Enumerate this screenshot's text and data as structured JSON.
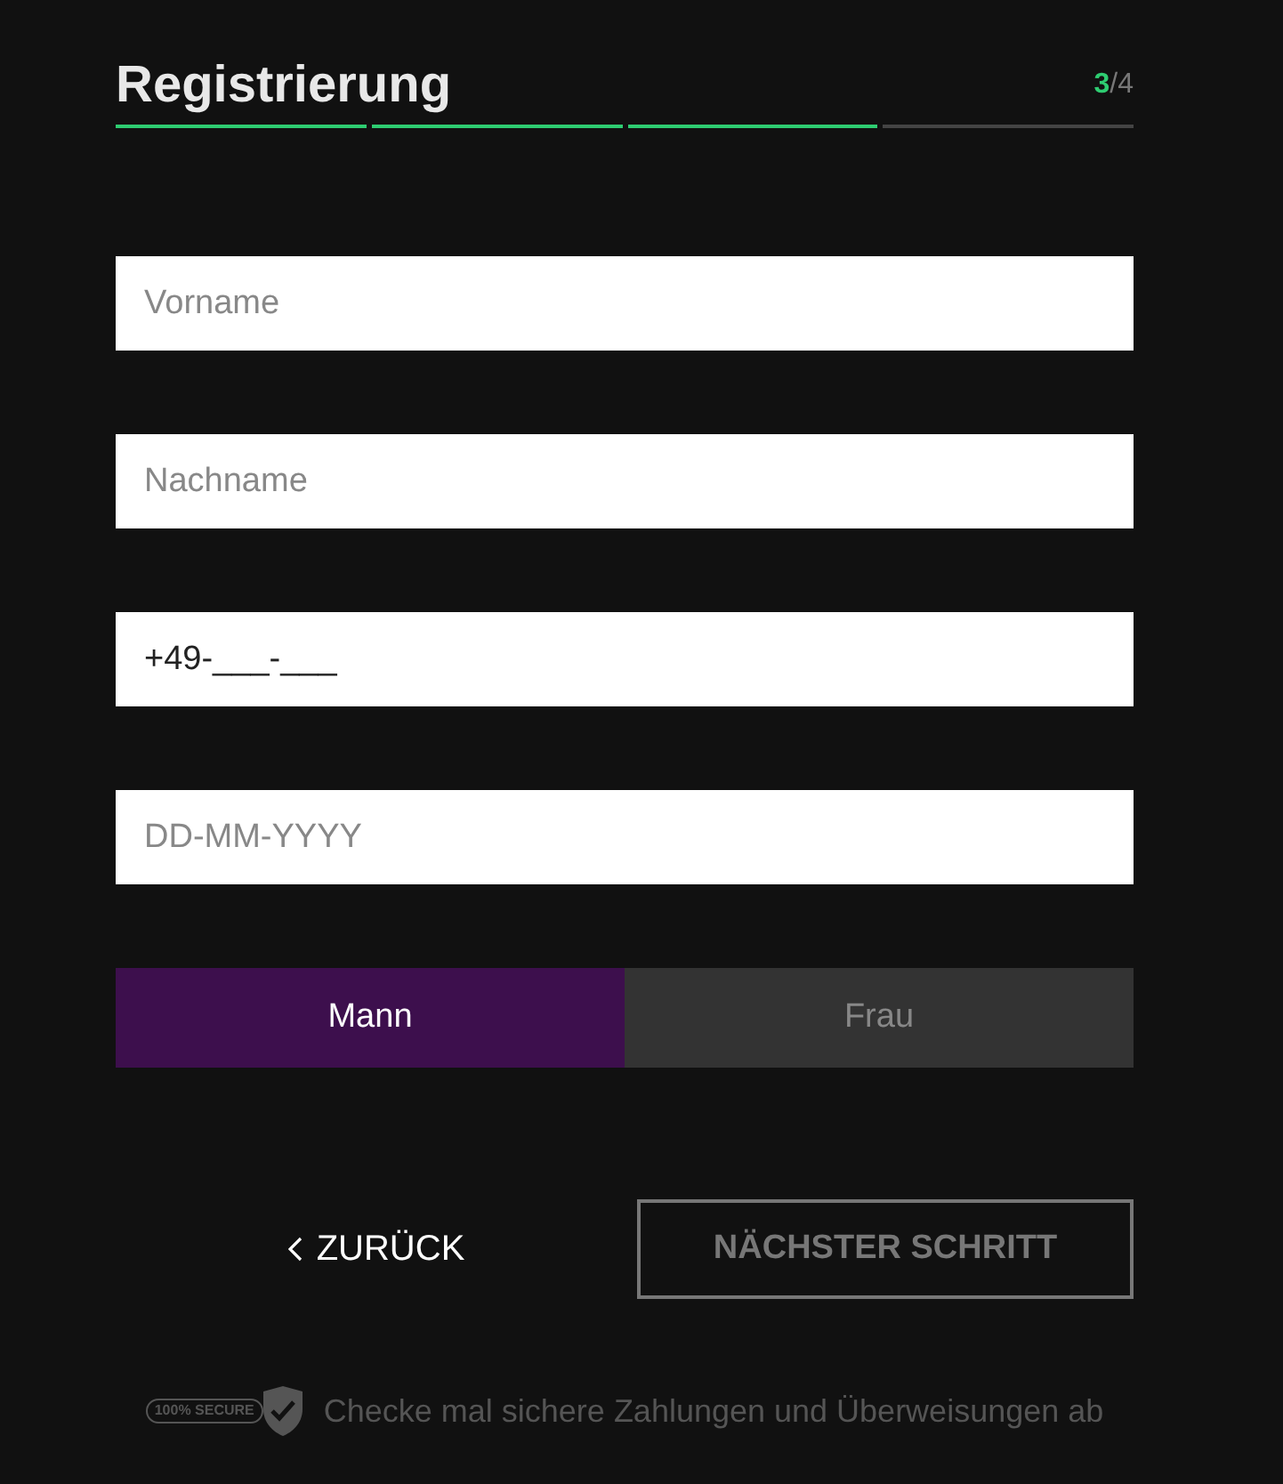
{
  "title": "Registrierung",
  "step": {
    "current": "3",
    "total": "/4"
  },
  "progress": [
    {
      "done": true
    },
    {
      "done": true
    },
    {
      "done": true
    },
    {
      "done": false
    }
  ],
  "fields": [
    {
      "placeholder": "Vorname"
    },
    {
      "placeholder": "Nachname"
    },
    {
      "value": "+49-___-___"
    },
    {
      "placeholder": "DD-MM-YYYY"
    }
  ],
  "gender": [
    {
      "label": "Mann",
      "selected": true
    },
    {
      "label": "Frau",
      "selected": false
    }
  ],
  "back_button": {
    "label": "ZURÜCK"
  },
  "next_button": {
    "label": "NÄCHSTER SCHRITT",
    "disabled": true
  },
  "footer": {
    "badge": "100% SECURE",
    "text": "Checke mal sichere Zahlungen und Überweisungen ab"
  }
}
